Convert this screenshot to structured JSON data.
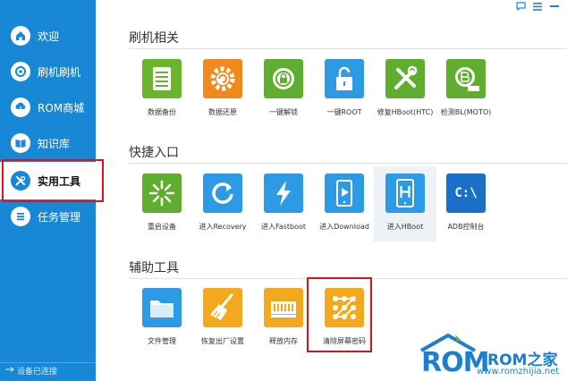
{
  "window_controls": [
    "chat-bubble-icon",
    "menu-icon",
    "minimize-icon"
  ],
  "sidebar": {
    "items": [
      {
        "label": "欢迎",
        "icon": "home-icon"
      },
      {
        "label": "刷机刷机",
        "icon": "flash-icon"
      },
      {
        "label": "ROM商城",
        "icon": "cloud-download-icon"
      },
      {
        "label": "知识库",
        "icon": "book-icon"
      },
      {
        "label": "实用工具",
        "icon": "tools-icon",
        "active": true
      },
      {
        "label": "任务管理",
        "icon": "list-icon"
      }
    ],
    "status": "设备已连接"
  },
  "sections": [
    {
      "title": "刷机相关",
      "items": [
        {
          "label": "数据备份",
          "icon": "backup-icon",
          "color": "#6bb52c"
        },
        {
          "label": "数据还原",
          "icon": "restore-gear-icon",
          "color": "#f08a1c"
        },
        {
          "label": "一键解锁",
          "icon": "unlock-disc-icon",
          "color": "#5fae2f"
        },
        {
          "label": "一键ROOT",
          "icon": "padlock-icon",
          "color": "#2d9ae6"
        },
        {
          "label": "修复HBoot(HTC)",
          "icon": "wrench-tools-icon",
          "color": "#5fae2f"
        },
        {
          "label": "检测BL(MOTO)",
          "icon": "bl-check-icon",
          "color": "#5fae2f"
        }
      ]
    },
    {
      "title": "快捷入口",
      "items": [
        {
          "label": "重启设备",
          "icon": "burst-icon",
          "color": "#5fae2f"
        },
        {
          "label": "进入Recovery",
          "icon": "refresh-icon",
          "color": "#2d9ae6"
        },
        {
          "label": "进入Fastboot",
          "icon": "lightning-icon",
          "color": "#2d9ae6"
        },
        {
          "label": "进入Download",
          "icon": "phone-play-icon",
          "color": "#2d9ae6"
        },
        {
          "label": "进入HBoot",
          "icon": "phone-h-icon",
          "color": "#2d9ae6",
          "selected": true
        },
        {
          "label": "ADB控制台",
          "icon": "terminal-icon",
          "color": "#1a6fc7",
          "text": "C:\\"
        }
      ]
    },
    {
      "title": "辅助工具",
      "items": [
        {
          "label": "文件管理",
          "icon": "folder-icon",
          "color": "#2d9ae6"
        },
        {
          "label": "恢复出厂设置",
          "icon": "broom-icon",
          "color": "#f3a91d"
        },
        {
          "label": "释放内存",
          "icon": "memory-chip-icon",
          "color": "#f3a91d"
        },
        {
          "label": "清除屏幕密码",
          "icon": "pattern-lock-icon",
          "color": "#f3a91d",
          "highlighted": true
        }
      ]
    }
  ],
  "watermark": {
    "logo": "ROM",
    "brand": "ROM之家",
    "url": "www.romzhijia.net"
  }
}
